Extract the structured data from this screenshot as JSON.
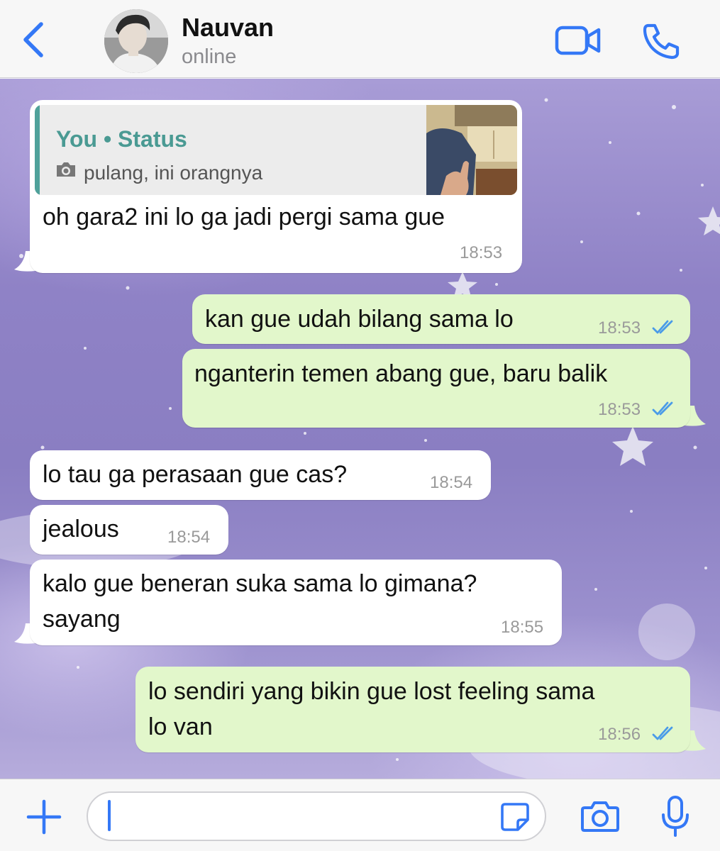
{
  "header": {
    "contact_name": "Nauvan",
    "contact_status": "online"
  },
  "icons": {
    "back": "chevron-left-icon",
    "video": "video-camera-icon",
    "call": "phone-icon",
    "plus": "plus-icon",
    "sticker": "sticker-icon",
    "camera": "camera-icon",
    "mic": "microphone-icon",
    "read_receipt": "double-check-icon"
  },
  "colors": {
    "accent": "#3478f6",
    "outgoing_bubble": "#e2f7cb",
    "incoming_bubble": "#ffffff",
    "quote_accent": "#4fa19a",
    "read_ticks": "#4a9be8"
  },
  "messages": [
    {
      "direction": "incoming",
      "quote": {
        "title": "You • Status",
        "text": "pulang, ini orangnya"
      },
      "text": "oh gara2 ini lo ga jadi pergi sama gue",
      "time": "18:53"
    },
    {
      "direction": "outgoing",
      "text": "kan gue udah bilang sama lo",
      "time": "18:53",
      "read": true
    },
    {
      "direction": "outgoing",
      "text": "nganterin temen abang gue, baru balik",
      "time": "18:53",
      "read": true
    },
    {
      "direction": "incoming",
      "text": "lo tau ga perasaan gue cas?",
      "time": "18:54"
    },
    {
      "direction": "incoming",
      "text": "jealous",
      "time": "18:54"
    },
    {
      "direction": "incoming",
      "lines": [
        "kalo gue beneran suka sama lo gimana?",
        "sayang"
      ],
      "time": "18:55"
    },
    {
      "direction": "outgoing",
      "lines": [
        "lo sendiri yang bikin gue lost feeling sama",
        "lo van"
      ],
      "time": "18:56",
      "read": true
    }
  ],
  "composer": {
    "value": ""
  }
}
